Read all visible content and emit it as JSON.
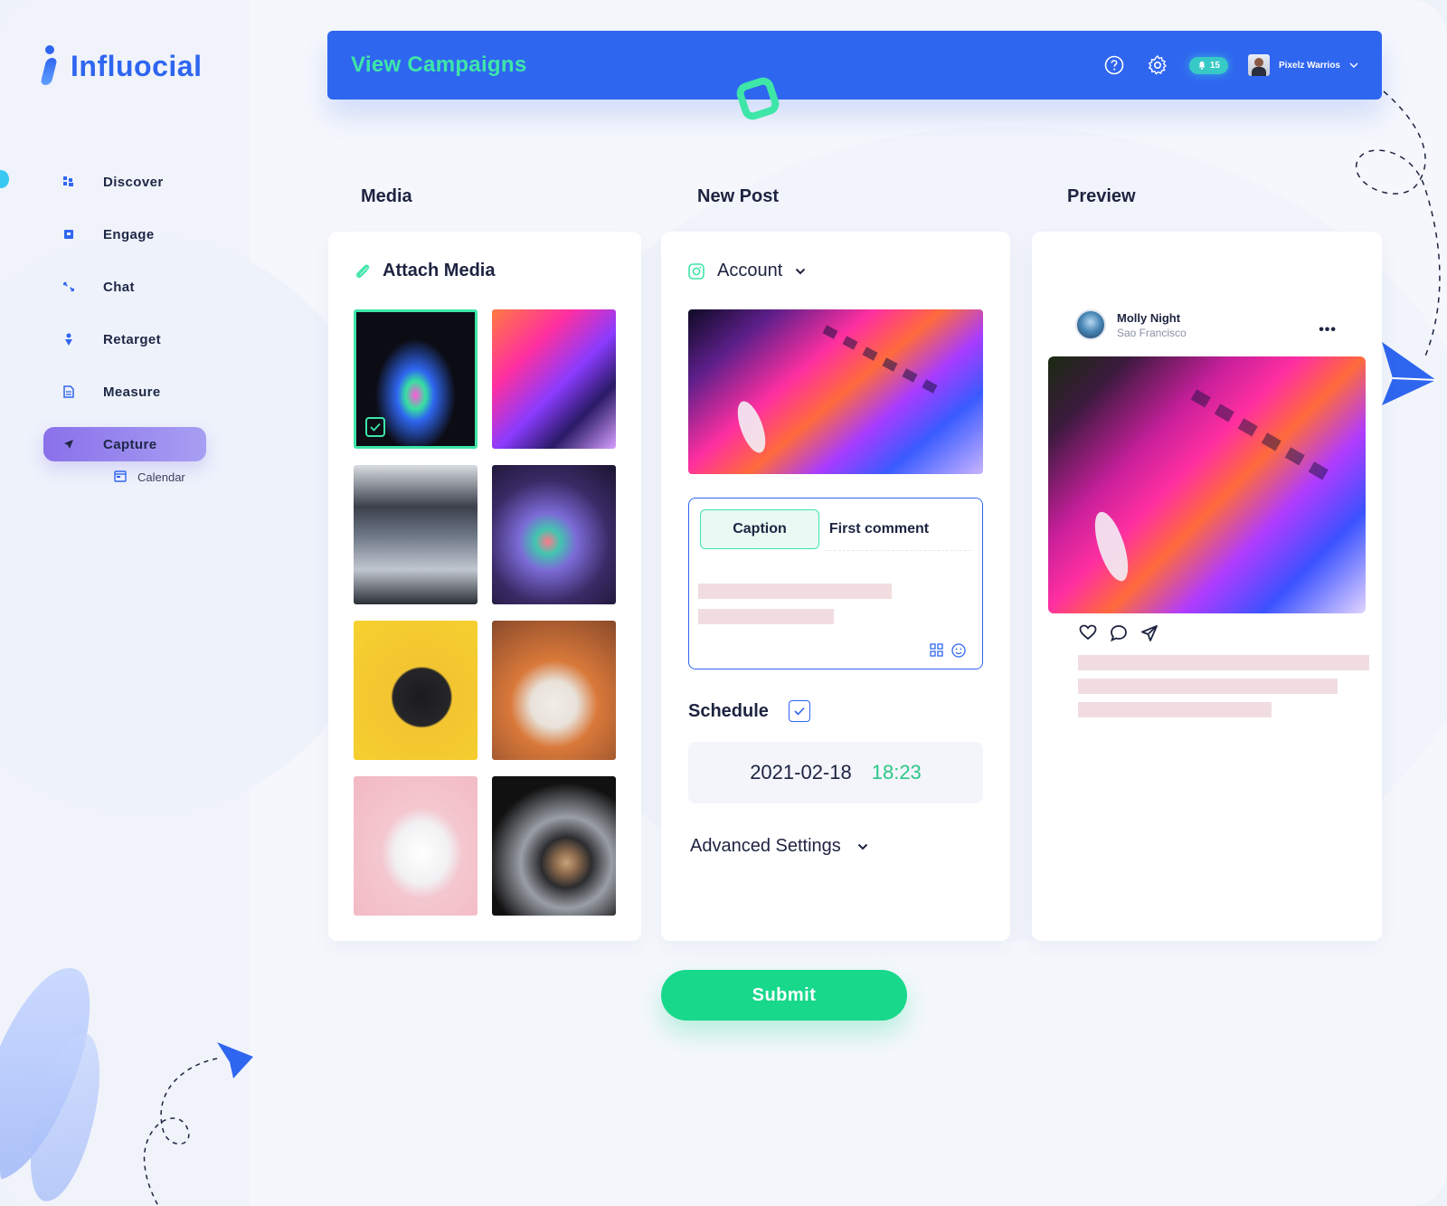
{
  "brand": {
    "name": "Influocial"
  },
  "sidebar": {
    "items": [
      {
        "label": "Discover",
        "icon": "grid-icon"
      },
      {
        "label": "Engage",
        "icon": "square-icon"
      },
      {
        "label": "Chat",
        "icon": "arrows-icon"
      },
      {
        "label": "Retarget",
        "icon": "pin-icon"
      },
      {
        "label": "Measure",
        "icon": "document-icon"
      },
      {
        "label": "Capture",
        "icon": "rocket-icon",
        "active": true
      }
    ],
    "sub_item": {
      "label": "Calendar",
      "icon": "calendar-icon"
    }
  },
  "header": {
    "title": "View Campaigns",
    "notifications": "15",
    "user_name": "Pixelz Warrios"
  },
  "columns": {
    "media": "Media",
    "new_post": "New Post",
    "preview": "Preview"
  },
  "media": {
    "attach_label": "Attach Media",
    "thumbnails": [
      "laptop-keyboard-rgb",
      "laptop-phone-colorful",
      "laptop-apps-screen",
      "phone-bokeh",
      "headphones-yellow",
      "airpods-case",
      "airpods-pink",
      "devices-flatlay"
    ],
    "selected_index": 0
  },
  "new_post": {
    "account_label": "Account",
    "tabs": [
      "Caption",
      "First comment"
    ],
    "active_tab": "Caption",
    "schedule_label": "Schedule",
    "schedule_checked": true,
    "date": "2021-02-18",
    "time": "18:23",
    "advanced_label": "Advanced Settings"
  },
  "preview": {
    "user_name": "Molly Night",
    "location": "Sao Francisco",
    "more": "•••"
  },
  "submit_label": "Submit",
  "colors": {
    "primary": "#2f66f0",
    "accent_green": "#3ee6a8",
    "submit": "#17d88b",
    "active_nav": "#8a70ea",
    "time": "#2cc786"
  }
}
